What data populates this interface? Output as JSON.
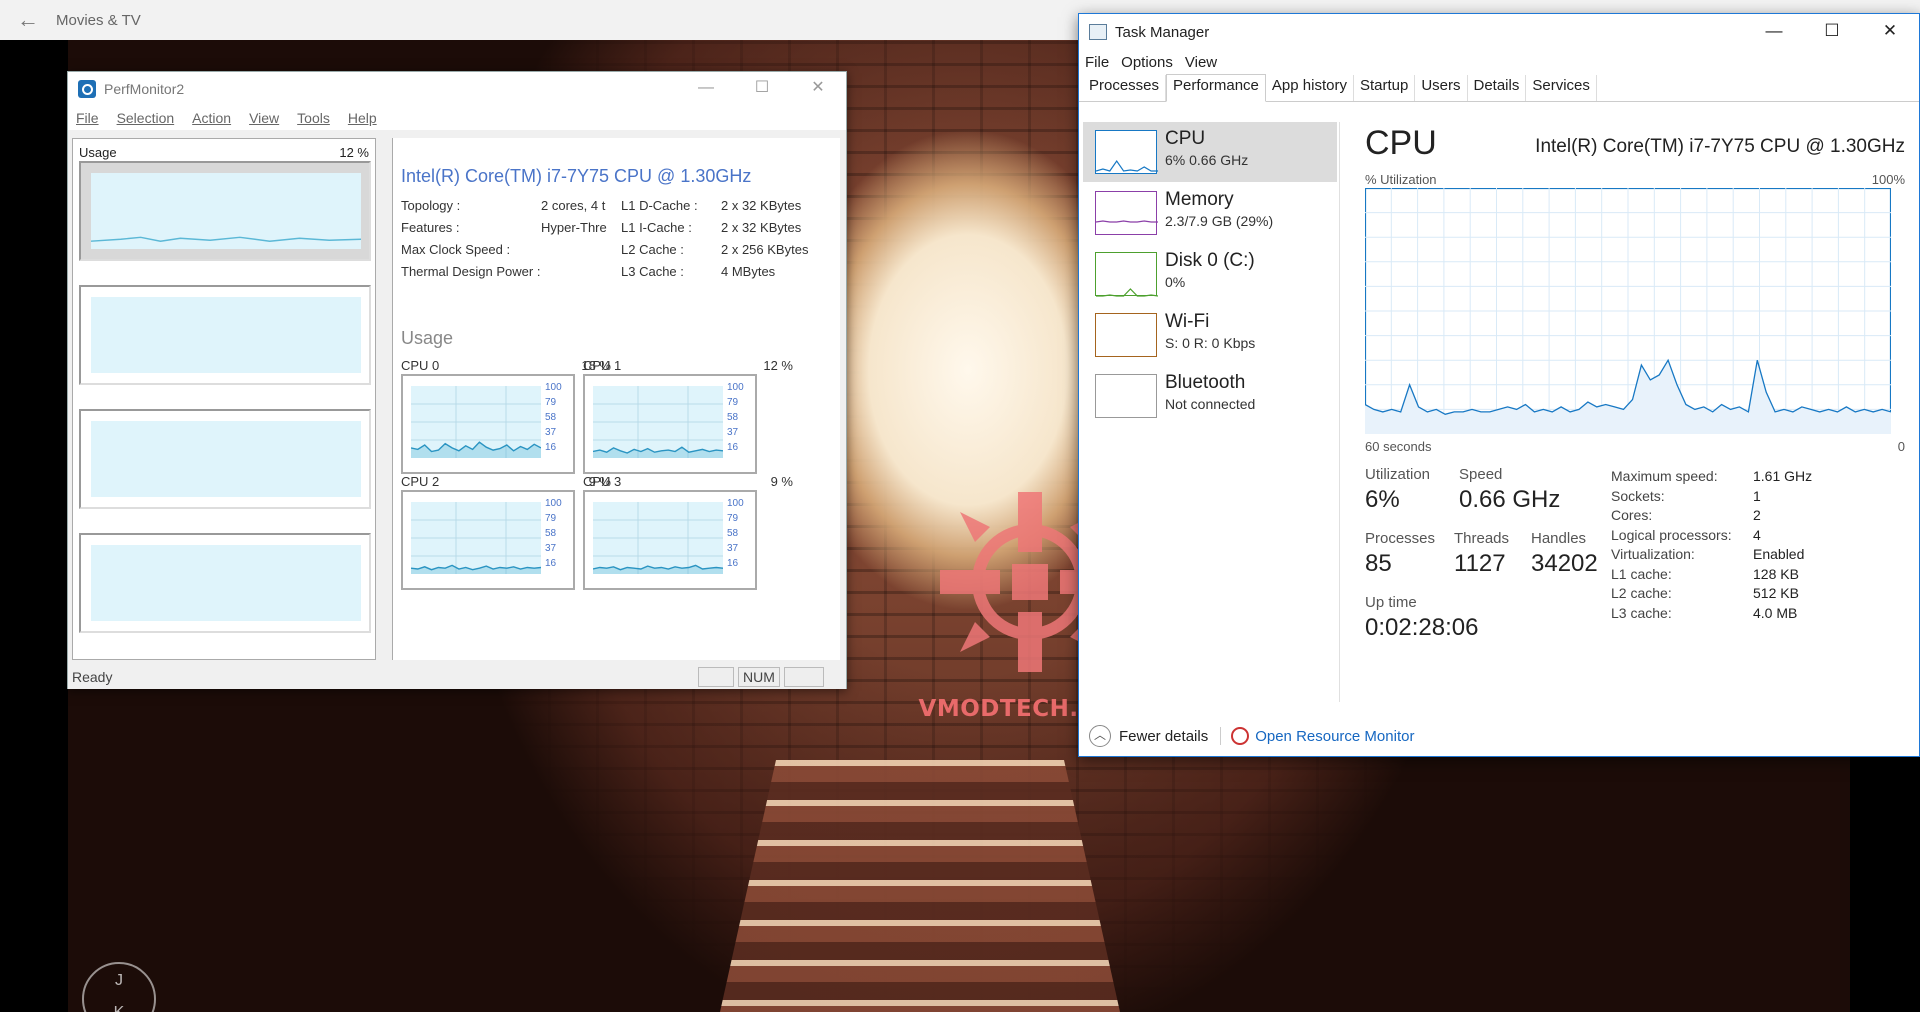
{
  "movies_tv": {
    "title": "Movies & TV",
    "back_glyph": "←"
  },
  "watermark": {
    "brand": "VMODTECH.COM",
    "badge_top": "J",
    "badge_bottom": "K"
  },
  "perfmonitor": {
    "title": "PerfMonitor2",
    "menu": [
      "File",
      "Selection",
      "Action",
      "View",
      "Tools",
      "Help"
    ],
    "left_panel": {
      "usage_label": "Usage",
      "usage_value": "12 %"
    },
    "cpu_name": "Intel(R) Core(TM) i7-7Y75 CPU @ 1.30GHz",
    "specs_left": [
      {
        "label": "Topology :",
        "value": "2 cores, 4 t"
      },
      {
        "label": "Features :",
        "value": "Hyper-Thre"
      },
      {
        "label": "Max Clock Speed :",
        "value": ""
      },
      {
        "label": "Thermal Design Power :",
        "value": ""
      }
    ],
    "specs_right": [
      {
        "label": "L1 D-Cache :",
        "value": "2 x 32 KBytes"
      },
      {
        "label": "L1 I-Cache :",
        "value": "2 x 32 KBytes"
      },
      {
        "label": "L2 Cache :",
        "value": "2 x 256 KBytes"
      },
      {
        "label": "L3 Cache :",
        "value": "4 MBytes"
      }
    ],
    "usage_title": "Usage",
    "cores": [
      {
        "name": "CPU 0",
        "pct": "18 %",
        "values": [
          14,
          12,
          18,
          9,
          11,
          20,
          14,
          10,
          17,
          12,
          22,
          15,
          11,
          13,
          18,
          10,
          16,
          12,
          19,
          14
        ]
      },
      {
        "name": "CPU 1",
        "pct": "12 %",
        "values": [
          9,
          11,
          8,
          14,
          10,
          7,
          12,
          9,
          13,
          8,
          10,
          11,
          9,
          15,
          8,
          10,
          12,
          9,
          11,
          10
        ]
      },
      {
        "name": "CPU 2",
        "pct": "9 %",
        "values": [
          8,
          7,
          10,
          6,
          9,
          8,
          12,
          7,
          9,
          6,
          8,
          11,
          7,
          9,
          8,
          10,
          7,
          9,
          8,
          9
        ]
      },
      {
        "name": "CPU 3",
        "pct": "9 %",
        "values": [
          7,
          9,
          8,
          10,
          6,
          9,
          8,
          7,
          11,
          8,
          9,
          7,
          10,
          8,
          9,
          12,
          7,
          8,
          9,
          8
        ]
      }
    ],
    "tick_labels": [
      "100",
      "79",
      "58",
      "37",
      "16"
    ],
    "status": "Ready",
    "num_indicator": "NUM"
  },
  "task_manager": {
    "title": "Task Manager",
    "window_buttons": {
      "minimize": "—",
      "maximize": "☐",
      "close": "✕"
    },
    "menu": [
      "File",
      "Options",
      "View"
    ],
    "tabs": [
      "Processes",
      "Performance",
      "App history",
      "Startup",
      "Users",
      "Details",
      "Services"
    ],
    "active_tab": "Performance",
    "sidebar": [
      {
        "name": "CPU",
        "sub": "6% 0.66 GHz",
        "color": "#1778c4"
      },
      {
        "name": "Memory",
        "sub": "2.3/7.9 GB (29%)",
        "color": "#8b3fa8"
      },
      {
        "name": "Disk 0 (C:)",
        "sub": "0%",
        "color": "#4da02e"
      },
      {
        "name": "Wi-Fi",
        "sub": "S: 0 R: 0 Kbps",
        "color": "#a5641e"
      },
      {
        "name": "Bluetooth",
        "sub": "Not connected",
        "color": "#999999"
      }
    ],
    "heading": "CPU",
    "cpu_model": "Intel(R) Core(TM) i7-7Y75 CPU @ 1.30GHz",
    "graph_label": "% Utilization",
    "graph_max": "100%",
    "graph_time": "60 seconds",
    "graph_zero": "0",
    "graph_values": [
      12,
      10,
      9,
      10,
      9,
      20,
      11,
      9,
      10,
      8,
      9,
      9,
      10,
      9,
      9,
      10,
      11,
      10,
      12,
      9,
      10,
      9,
      11,
      9,
      10,
      13,
      11,
      12,
      11,
      10,
      14,
      28,
      22,
      24,
      30,
      20,
      12,
      10,
      11,
      9,
      12,
      10,
      11,
      9,
      30,
      17,
      9,
      10,
      9,
      11,
      10,
      9,
      10,
      9,
      11,
      9,
      10,
      9,
      10,
      9
    ],
    "stats": {
      "utilization_label": "Utilization",
      "utilization": "6%",
      "speed_label": "Speed",
      "speed": "0.66 GHz",
      "processes_label": "Processes",
      "processes": "85",
      "threads_label": "Threads",
      "threads": "1127",
      "handles_label": "Handles",
      "handles": "34202",
      "uptime_label": "Up time",
      "uptime": "0:02:28:06"
    },
    "details": [
      {
        "k": "Maximum speed:",
        "v": "1.61 GHz"
      },
      {
        "k": "Sockets:",
        "v": "1"
      },
      {
        "k": "Cores:",
        "v": "2"
      },
      {
        "k": "Logical processors:",
        "v": "4"
      },
      {
        "k": "Virtualization:",
        "v": "Enabled"
      },
      {
        "k": "L1 cache:",
        "v": "128 KB"
      },
      {
        "k": "L2 cache:",
        "v": "512 KB"
      },
      {
        "k": "L3 cache:",
        "v": "4.0 MB"
      }
    ],
    "footer": {
      "fewer_details": "Fewer details",
      "open_resource_monitor": "Open Resource Monitor"
    },
    "accent": "#1778c4"
  }
}
